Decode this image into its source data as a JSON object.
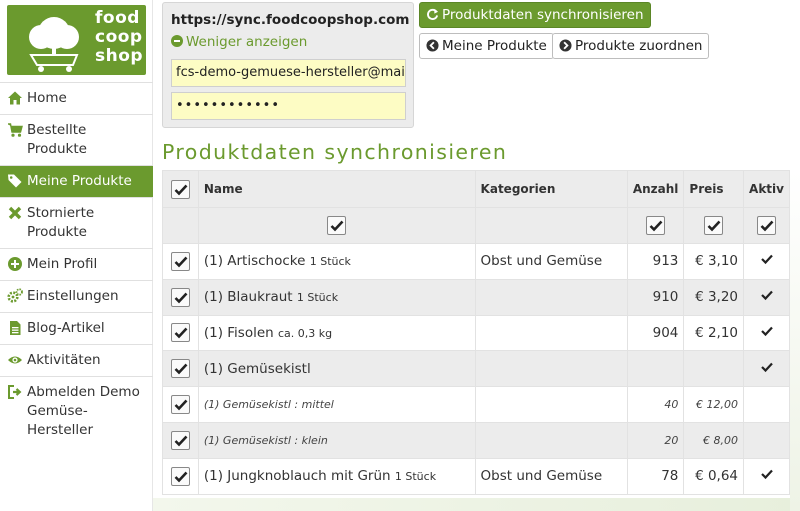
{
  "logo": {
    "line1": "food",
    "line2": "coop",
    "line3": "shop"
  },
  "nav": [
    {
      "label": "Home",
      "icon": "home-icon",
      "active": false
    },
    {
      "label": "Bestellte Produkte",
      "icon": "cart-icon",
      "active": false
    },
    {
      "label": "Meine Produkte",
      "icon": "tags-icon",
      "active": true
    },
    {
      "label": "Stornierte Produkte",
      "icon": "close-icon",
      "active": false
    },
    {
      "label": "Mein Profil",
      "icon": "plus-circle-icon",
      "active": false
    },
    {
      "label": "Einstellungen",
      "icon": "cogs-icon",
      "active": false
    },
    {
      "label": "Blog-Artikel",
      "icon": "file-icon",
      "active": false
    },
    {
      "label": "Aktivitäten",
      "icon": "eye-icon",
      "active": false
    },
    {
      "label": "Abmelden Demo Gemüse-Hersteller",
      "icon": "sign-out-icon",
      "active": false
    }
  ],
  "login": {
    "server_url": "https://sync.foodcoopshop.com",
    "toggle_label": "Weniger anzeigen",
    "email_value": "fcs-demo-gemuese-hersteller@mai",
    "password_value": "••••••••••••"
  },
  "toolbar": {
    "sync_label": "Produktdaten synchronisieren",
    "my_products_label": "Meine Produkte",
    "assign_label": "Produkte zuordnen"
  },
  "section_title": "Produktdaten synchronisieren",
  "table": {
    "headers": {
      "name": "Name",
      "category": "Kategorien",
      "count": "Anzahl",
      "price": "Preis",
      "active": "Aktiv"
    },
    "rows": [
      {
        "name": "(1) Artischocke",
        "qty": "1 Stück",
        "category": "Obst und Gemüse",
        "count": "913",
        "price": "€ 3,10",
        "active": true,
        "variant": false
      },
      {
        "name": "(1) Blaukraut",
        "qty": "1 Stück",
        "category": "",
        "count": "910",
        "price": "€ 3,20",
        "active": true,
        "variant": false
      },
      {
        "name": "(1) Fisolen",
        "qty": "ca. 0,3 kg",
        "category": "",
        "count": "904",
        "price": "€ 2,10",
        "active": true,
        "variant": false
      },
      {
        "name": "(1) Gemüsekistl",
        "qty": "",
        "category": "",
        "count": "",
        "price": "",
        "active": true,
        "variant": false
      },
      {
        "name": "(1) Gemüsekistl : mittel",
        "qty": "",
        "category": "",
        "count": "40",
        "price": "€ 12,00",
        "active": false,
        "variant": true
      },
      {
        "name": "(1) Gemüsekistl : klein",
        "qty": "",
        "category": "",
        "count": "20",
        "price": "€ 8,00",
        "active": false,
        "variant": true
      },
      {
        "name": "(1) Jungknoblauch mit Grün",
        "qty": "1 Stück",
        "category": "Obst und Gemüse",
        "count": "78",
        "price": "€ 0,64",
        "active": true,
        "variant": false
      }
    ]
  },
  "colors": {
    "brand": "#6b9a2e",
    "row_alt": "#ececec",
    "field_bg": "#fdfcc4"
  }
}
